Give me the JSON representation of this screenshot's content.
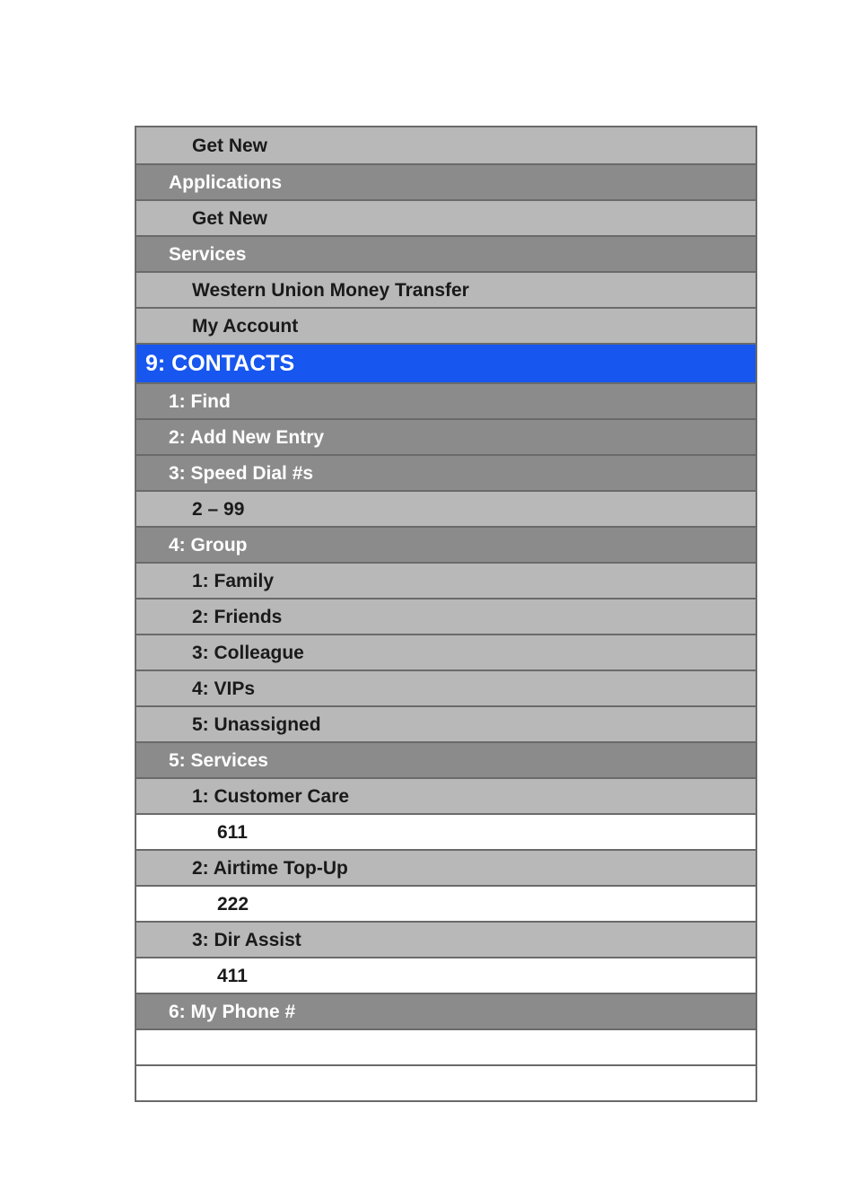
{
  "rows": [
    {
      "level": 2,
      "label": "Get New"
    },
    {
      "level": 1,
      "label": "Applications"
    },
    {
      "level": 2,
      "label": "Get New"
    },
    {
      "level": 1,
      "label": "Services"
    },
    {
      "level": 2,
      "label": "Western Union Money Transfer"
    },
    {
      "level": 2,
      "label": "My Account"
    },
    {
      "level": 0,
      "label": "9: CONTACTS"
    },
    {
      "level": 1,
      "label": "1: Find"
    },
    {
      "level": 1,
      "label": "2: Add New Entry"
    },
    {
      "level": 1,
      "label": "3: Speed Dial #s"
    },
    {
      "level": 2,
      "label": "2 – 99"
    },
    {
      "level": 1,
      "label": "4: Group"
    },
    {
      "level": 2,
      "label": "1: Family"
    },
    {
      "level": 2,
      "label": "2: Friends"
    },
    {
      "level": 2,
      "label": "3: Colleague"
    },
    {
      "level": 2,
      "label": "4: VIPs"
    },
    {
      "level": 2,
      "label": "5: Unassigned"
    },
    {
      "level": 1,
      "label": "5: Services"
    },
    {
      "level": 2,
      "label": "1: Customer Care"
    },
    {
      "level": 3,
      "label": "611"
    },
    {
      "level": 2,
      "label": "2: Airtime Top-Up"
    },
    {
      "level": 3,
      "label": "222"
    },
    {
      "level": 2,
      "label": "3: Dir Assist"
    },
    {
      "level": 3,
      "label": "411"
    },
    {
      "level": 1,
      "label": "6: My Phone #"
    },
    {
      "level": 4,
      "label": ""
    },
    {
      "level": 4,
      "label": ""
    }
  ]
}
